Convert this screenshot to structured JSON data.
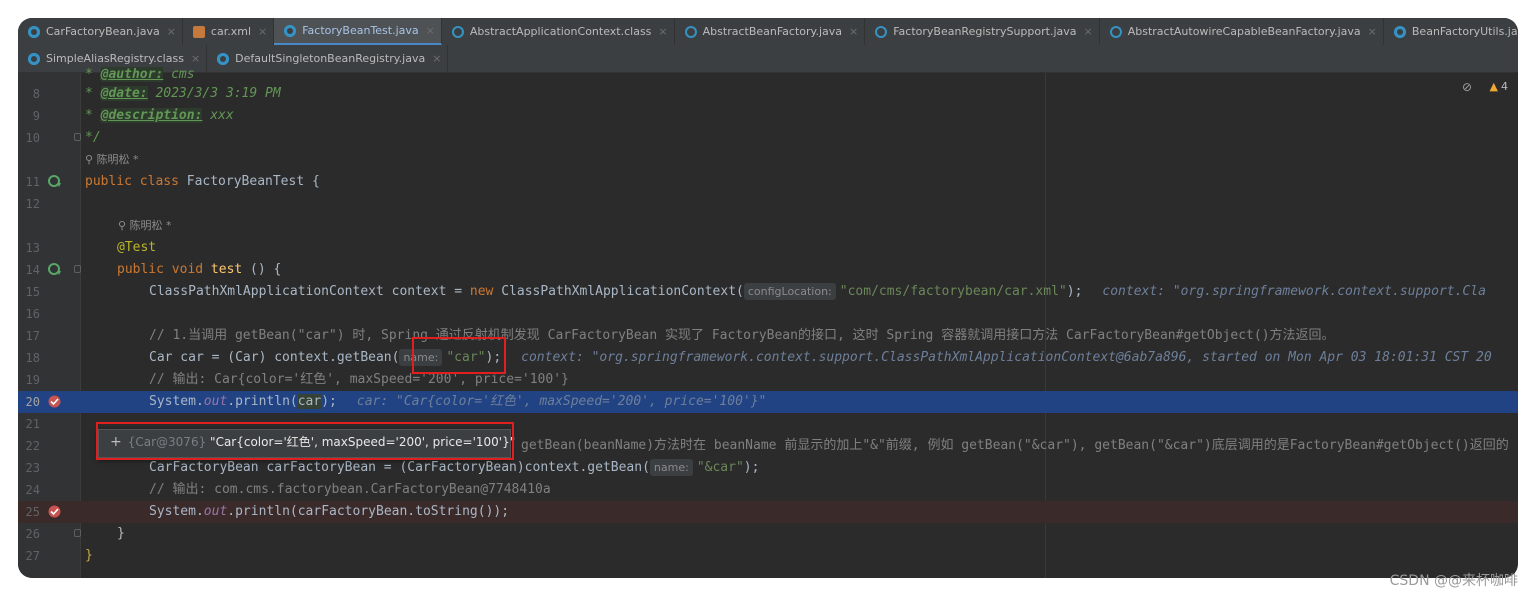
{
  "tabs_row1": [
    {
      "label": "CarFactoryBean.java",
      "icon": "c",
      "active": false
    },
    {
      "label": "car.xml",
      "icon": "xml",
      "active": false
    },
    {
      "label": "FactoryBeanTest.java",
      "icon": "c",
      "active": true
    },
    {
      "label": "AbstractApplicationContext.class",
      "icon": "cls",
      "active": false
    },
    {
      "label": "AbstractBeanFactory.java",
      "icon": "cls",
      "active": false
    },
    {
      "label": "FactoryBeanRegistrySupport.java",
      "icon": "cls",
      "active": false
    },
    {
      "label": "AbstractAutowireCapableBeanFactory.java",
      "icon": "cls",
      "active": false
    },
    {
      "label": "BeanFactoryUtils.java",
      "icon": "c",
      "active": false
    }
  ],
  "tabs_row2": [
    {
      "label": "SimpleAliasRegistry.class",
      "icon": "c",
      "active": false
    },
    {
      "label": "DefaultSingletonBeanRegistry.java",
      "icon": "c",
      "active": false
    }
  ],
  "close_glyph": "×",
  "inspections": {
    "warning_count": "4",
    "warning_icon": "warning-triangle-icon",
    "eye_icon": "eye-slash-icon"
  },
  "code": {
    "l8_num": "8",
    "l8_tag": "@date:",
    "l8_text": " 2023/3/3 3:19 PM",
    "l9_num": "9",
    "l9_tag": "@description:",
    "l9_text": " xxx",
    "l10_num": "10",
    "l10_text": "*/",
    "author1": "陈明松 *",
    "l11_num": "11",
    "l11_kw": "public class ",
    "l11_text": "FactoryBeanTest {",
    "l12_num": "12",
    "author2": "陈明松 *",
    "l13_num": "13",
    "l13_text": "@Test",
    "l14_num": "14",
    "l14_kw": "public void ",
    "l14_fn": "test",
    "l14_text": " () {",
    "l15_num": "15",
    "l15_a": "ClassPathXmlApplicationContext context = ",
    "l15_kw": "new ",
    "l15_b": "ClassPathXmlApplicationContext(",
    "l15_hint": "configLocation:",
    "l15_str": "\"com/cms/factorybean/car.xml\"",
    "l15_c": ");",
    "l15_dbg": "context: \"org.springframework.context.support.Cla",
    "l16_num": "16",
    "l17_num": "17",
    "l17_text": "// 1.当调用 getBean(\"car\") 时, Spring 通过反射机制发现 CarFactoryBean 实现了 FactoryBean的接口, 这时 Spring 容器就调用接口方法 CarFactoryBean#getObject()方法返回。",
    "l18_num": "18",
    "l18_a": "Car car = (Car) context.getBean(",
    "l18_hint": "name:",
    "l18_str": "\"car\"",
    "l18_c": ");",
    "l18_dbg": "context: \"org.springframework.context.support.ClassPathXmlApplicationContext@6ab7a896, started on Mon Apr 03 18:01:31 CST 20",
    "l19_num": "19",
    "l19_text": "// 输出: Car{color='红色', maxSpeed='200', price='100'}",
    "l20_num": "20",
    "l20_a": "System.",
    "l20_fld": "out",
    "l20_b": ".println(",
    "l20_var": "car",
    "l20_c": ");",
    "l20_dbg": "car: \"Car{color='红色', maxSpeed='200', price='100'}\"",
    "l21_num": "21",
    "l22_num": "22",
    "l22_text": "getBean(beanName)方法时在 beanName 前显示的加上\"&\"前缀, 例如 getBean(\"&car\"), getBean(\"&car\")底层调用的是FactoryBean#getObject()返回的",
    "l23_num": "23",
    "l23_a": "CarFactoryBean carFactoryBean = (CarFactoryBean)context.getBean(",
    "l23_hint": "name:",
    "l23_str": "\"&car\"",
    "l23_c": ");",
    "l24_num": "24",
    "l24_text": "// 输出: com.cms.factorybean.CarFactoryBean@7748410a",
    "l25_num": "25",
    "l25_a": "System.",
    "l25_fld": "out",
    "l25_b": ".println(carFactoryBean.",
    "l25_fn": "toString",
    "l25_c": "());",
    "l26_num": "26",
    "l26_text": "}",
    "l27_num": "27",
    "l27_text": "}"
  },
  "popup": {
    "plus": "+",
    "ref": "{Car@3076}",
    "value": "\"Car{color='红色', maxSpeed='200', price='100'}\""
  },
  "watermark": "CSDN @@来杯咖啡"
}
